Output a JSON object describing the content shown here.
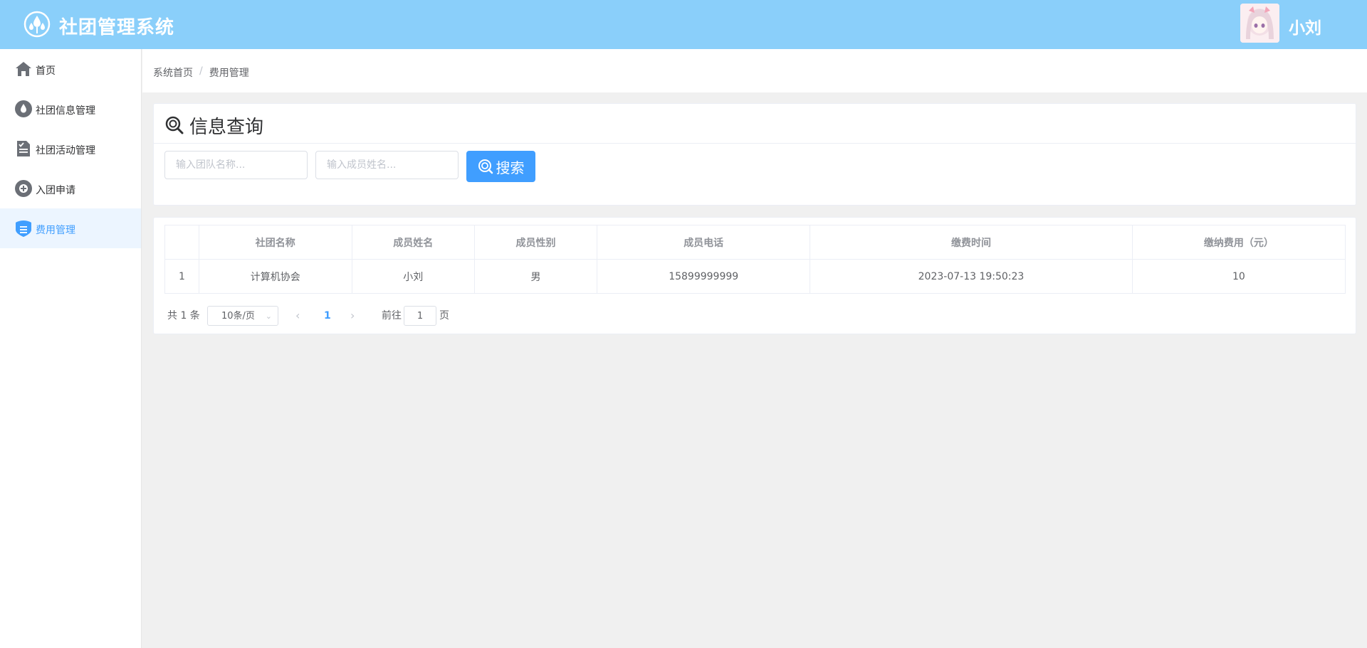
{
  "header": {
    "app_title": "社团管理系统",
    "username": "小刘"
  },
  "sidebar": {
    "items": [
      {
        "label": "首页",
        "icon": "home-icon"
      },
      {
        "label": "社团信息管理",
        "icon": "water-drop-icon"
      },
      {
        "label": "社团活动管理",
        "icon": "document-check-icon"
      },
      {
        "label": "入团申请",
        "icon": "add-circle-icon"
      },
      {
        "label": "费用管理",
        "icon": "wallet-icon",
        "active": true
      }
    ]
  },
  "breadcrumb": {
    "home": "系统首页",
    "separator": "/",
    "current": "费用管理"
  },
  "search": {
    "title": "信息查询",
    "team_placeholder": "输入团队名称...",
    "member_placeholder": "输入成员姓名...",
    "button_label": "搜索"
  },
  "table": {
    "columns": [
      "",
      "社团名称",
      "成员姓名",
      "成员性别",
      "成员电话",
      "缴费时间",
      "缴纳费用（元）"
    ],
    "rows": [
      [
        "1",
        "计算机协会",
        "小刘",
        "男",
        "15899999999",
        "2023-07-13 19:50:23",
        "10"
      ]
    ]
  },
  "pagination": {
    "total": "共 1 条",
    "page_size": "10条/页",
    "current_page": "1",
    "goto_label": "前往",
    "goto_value": "1",
    "page_unit": "页"
  },
  "colors": {
    "header_bg": "#8acffa",
    "accent": "#409eff",
    "active_bg": "#ecf5ff"
  }
}
